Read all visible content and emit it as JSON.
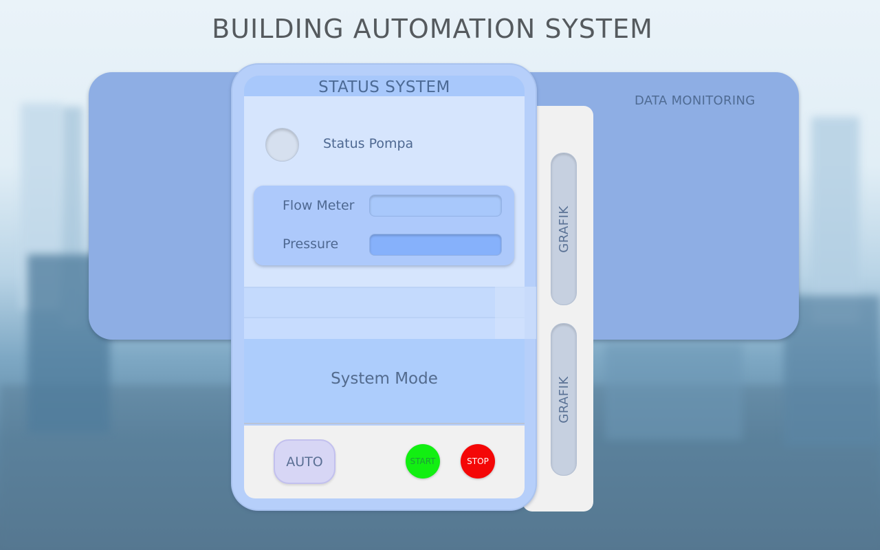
{
  "app": {
    "title": "BUILDING AUTOMATION SYSTEM"
  },
  "data_monitoring": {
    "label": "DATA MONITORING"
  },
  "status_system": {
    "header": "STATUS SYSTEM",
    "pump": {
      "label": "Status Pompa"
    },
    "flow_meter": {
      "label": "Flow Meter",
      "value": ""
    },
    "pressure": {
      "label": "Pressure",
      "value": ""
    },
    "mode": {
      "label": "System Mode"
    },
    "controls": {
      "auto_label": "AUTO",
      "start_label": "START",
      "stop_label": "STOP"
    }
  },
  "side": {
    "grafik_1": "GRAFIK",
    "grafik_2": "GRAFIK"
  },
  "colors": {
    "start": "#12ef12",
    "stop": "#f40707",
    "panel": "#8eaee4",
    "status": "#b6cffa",
    "auto": "#d7d6f5"
  }
}
